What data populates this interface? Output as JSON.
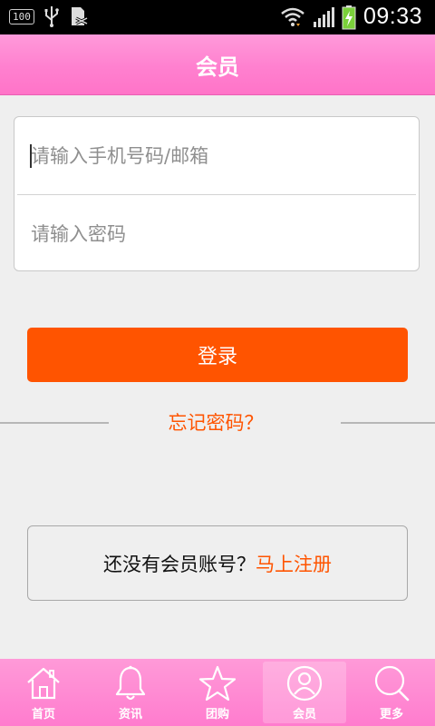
{
  "status_bar": {
    "battery_percent": "100",
    "time": "09:33"
  },
  "header": {
    "title": "会员"
  },
  "login_form": {
    "account_placeholder": "请输入手机号码/邮箱",
    "password_placeholder": "请输入密码"
  },
  "login_button": {
    "label": "登录"
  },
  "forgot_password": {
    "label": "忘记密码？"
  },
  "register": {
    "question": "还没有会员账号？",
    "link": "马上注册"
  },
  "tabs": [
    {
      "label": "首页",
      "icon": "home-icon"
    },
    {
      "label": "资讯",
      "icon": "bell-icon"
    },
    {
      "label": "团购",
      "icon": "star-icon"
    },
    {
      "label": "会员",
      "icon": "user-icon",
      "active": true
    },
    {
      "label": "更多",
      "icon": "search-icon"
    }
  ],
  "colors": {
    "accent": "#ff5400",
    "header_pink": "#ff80cf"
  }
}
